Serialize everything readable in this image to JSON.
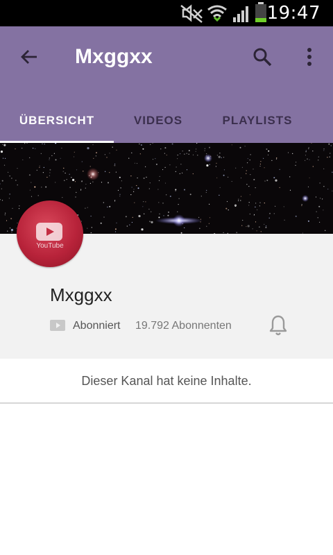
{
  "status_bar": {
    "time": "19:47",
    "icons": [
      "mute-icon",
      "wifi-icon",
      "signal-icon",
      "battery-icon"
    ]
  },
  "app_bar": {
    "title": "Mxggxx",
    "back_icon": "arrow-back-icon",
    "search_icon": "search-icon",
    "more_icon": "more-vert-icon",
    "background_color": "#8472a2"
  },
  "tabs": [
    {
      "label": "ÜBERSICHT",
      "active": true
    },
    {
      "label": "VIDEOS",
      "active": false
    },
    {
      "label": "PLAYLISTS",
      "active": false
    }
  ],
  "channel": {
    "name": "Mxggxx",
    "avatar_text": "YouTube",
    "subscription_status": "Abonniert",
    "subscriber_count": "19.792 Abonnenten",
    "bell_icon": "bell-icon"
  },
  "empty_message": "Dieser Kanal hat keine Inhalte."
}
